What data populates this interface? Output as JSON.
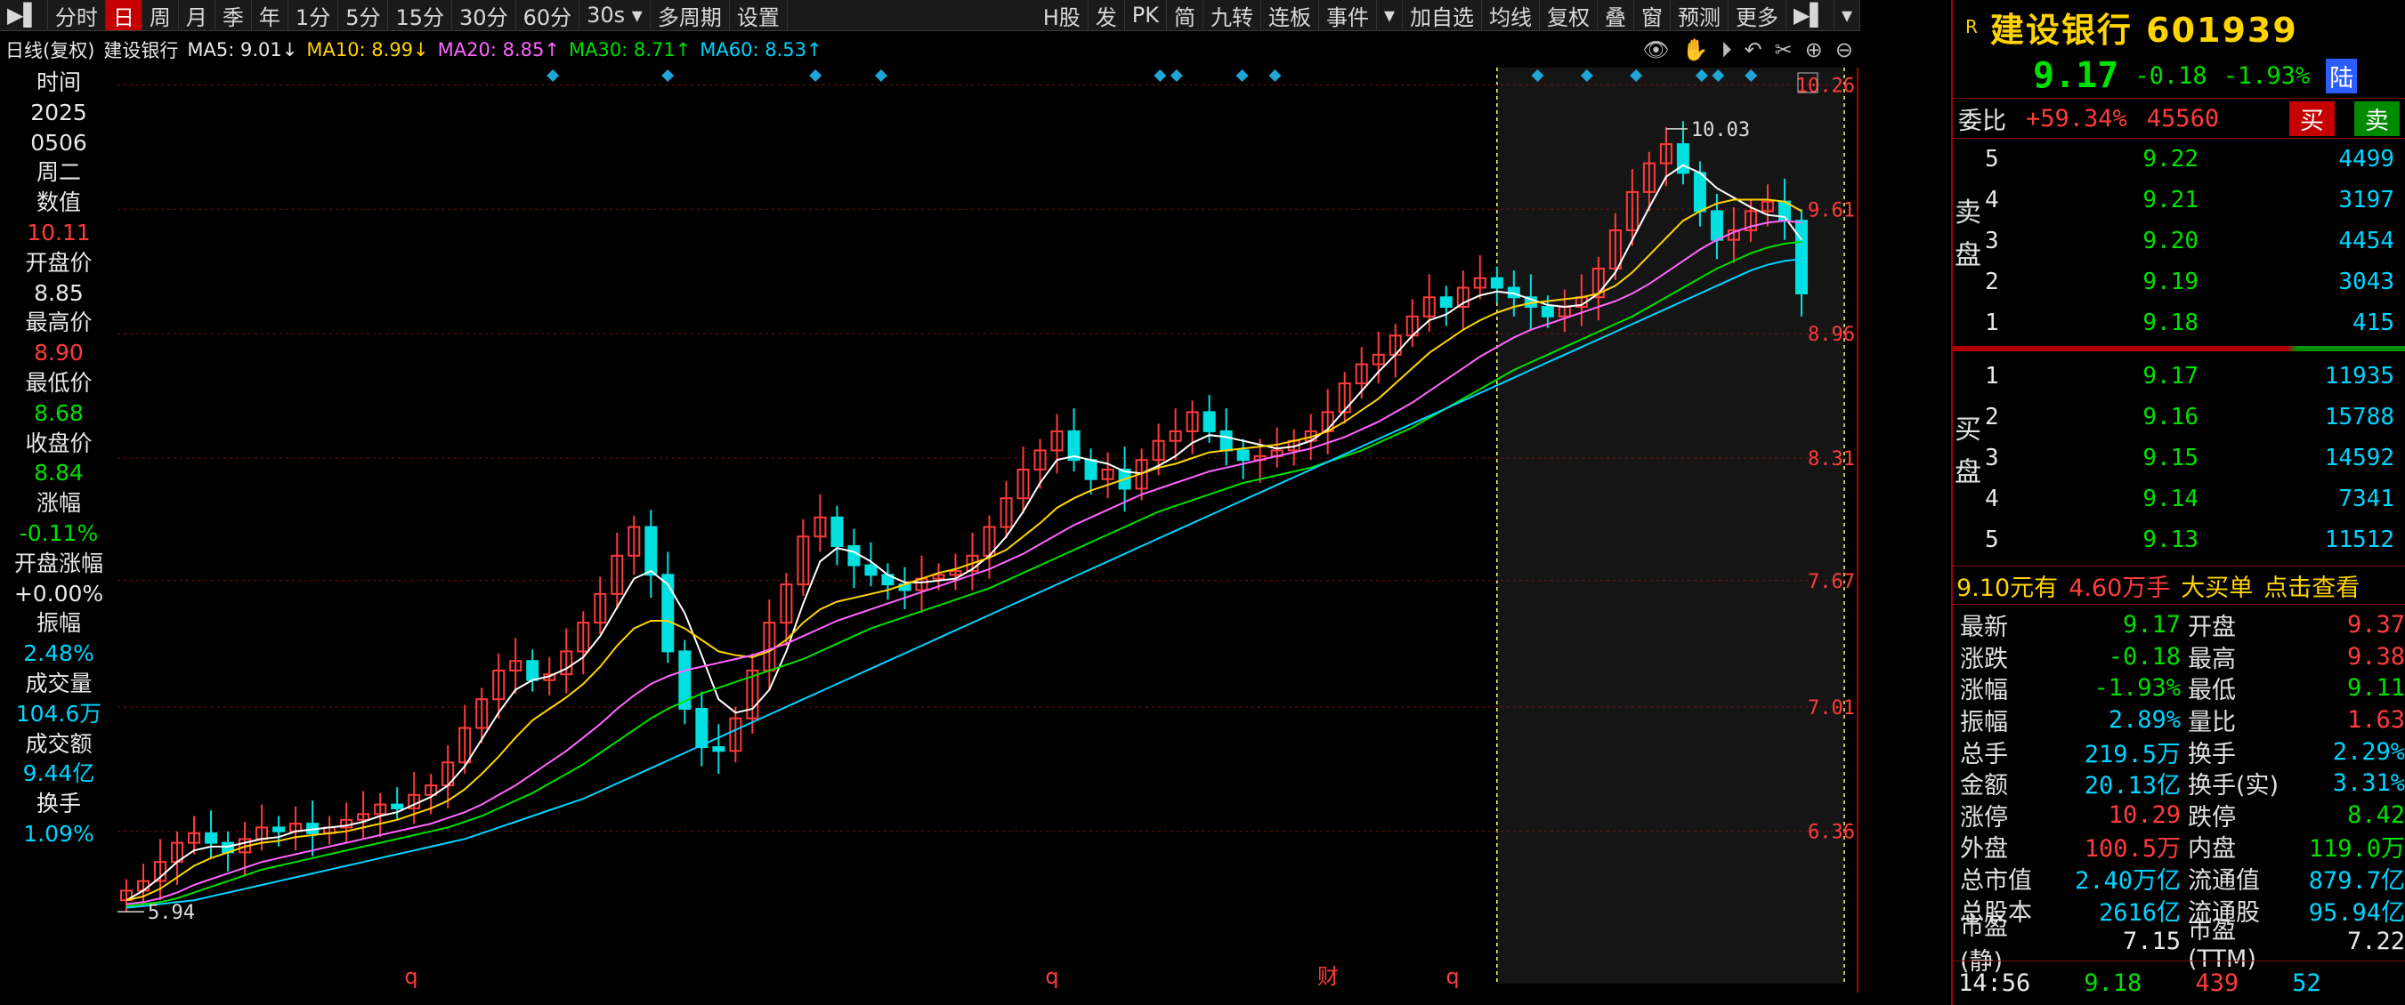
{
  "toolbar": {
    "items": [
      "分时",
      "日",
      "周",
      "月",
      "季",
      "年",
      "1分",
      "5分",
      "15分",
      "30分",
      "60分",
      "30s ▾",
      "多周期",
      "设置"
    ],
    "active_index": 1,
    "right_items": [
      "H股",
      "发",
      "PK",
      "简",
      "九转",
      "连板",
      "事件",
      "▾",
      "加自选",
      "均线",
      "复权",
      "叠",
      "窗",
      "预测",
      "更多"
    ]
  },
  "indicator": {
    "period": "日线(复权)",
    "stock": "建设银行",
    "ma5": "MA5: 9.01↓",
    "ma10": "MA10: 8.99↓",
    "ma20": "MA20: 8.85↑",
    "ma30": "MA30: 8.71↑",
    "ma60": "MA60: 8.53↑"
  },
  "left_panel": {
    "rows": [
      {
        "label": "时间",
        "value": "2025"
      },
      {
        "label": "",
        "value": "0506"
      },
      {
        "label": "",
        "value": "周二"
      },
      {
        "label": "数值",
        "value": "10.11"
      },
      {
        "label": "开盘价",
        "value": "8.85"
      },
      {
        "label": "最高价",
        "value": "8.90"
      },
      {
        "label": "最低价",
        "value": "8.68"
      },
      {
        "label": "收盘价",
        "value": "8.84"
      },
      {
        "label": "涨幅",
        "value": "-0.11%"
      },
      {
        "label": "开盘涨幅",
        "value": "+0.00%"
      },
      {
        "label": "振幅",
        "value": "2.48%"
      },
      {
        "label": "成交量",
        "value": "104.6万"
      },
      {
        "label": "成交额",
        "value": "9.44亿"
      },
      {
        "label": "换手",
        "value": "1.09%"
      }
    ]
  },
  "chart_data": {
    "type": "line",
    "title": "",
    "y_ticks": [
      "10.26",
      "9.61",
      "8.96",
      "8.31",
      "7.67",
      "7.01",
      "6.36"
    ],
    "ylim": [
      5.75,
      10.35
    ],
    "high_label": "10.03",
    "low_label": "5.94",
    "bottom_markers": [
      "q",
      "q",
      "财",
      "q"
    ],
    "series": [
      {
        "name": "close",
        "color": "#ff3b3b",
        "values": [
          6.05,
          6.1,
          6.2,
          6.3,
          6.35,
          6.3,
          6.25,
          6.32,
          6.38,
          6.36,
          6.4,
          6.35,
          6.38,
          6.42,
          6.45,
          6.5,
          6.48,
          6.55,
          6.6,
          6.72,
          6.9,
          7.05,
          7.2,
          7.25,
          7.15,
          7.18,
          7.3,
          7.45,
          7.6,
          7.8,
          7.95,
          7.7,
          7.3,
          7.0,
          6.8,
          6.78,
          6.95,
          7.2,
          7.45,
          7.65,
          7.9,
          8.0,
          7.85,
          7.75,
          7.7,
          7.65,
          7.62,
          7.68,
          7.7,
          7.72,
          7.8,
          7.95,
          8.1,
          8.25,
          8.35,
          8.45,
          8.3,
          8.2,
          8.25,
          8.15,
          8.3,
          8.4,
          8.45,
          8.55,
          8.45,
          8.35,
          8.3,
          8.32,
          8.35,
          8.4,
          8.45,
          8.55,
          8.7,
          8.8,
          8.85,
          8.95,
          9.05,
          9.15,
          9.1,
          9.2,
          9.25,
          9.2,
          9.15,
          9.1,
          9.05,
          9.1,
          9.15,
          9.3,
          9.5,
          9.7,
          9.85,
          9.95,
          9.8,
          9.6,
          9.45,
          9.5,
          9.6,
          9.65,
          9.55,
          9.17
        ]
      },
      {
        "name": "MA5",
        "color": "#ffffff",
        "values": [
          6.0,
          6.05,
          6.12,
          6.2,
          6.26,
          6.28,
          6.28,
          6.3,
          6.32,
          6.33,
          6.36,
          6.37,
          6.38,
          6.39,
          6.41,
          6.44,
          6.46,
          6.5,
          6.54,
          6.6,
          6.7,
          6.84,
          6.98,
          7.1,
          7.15,
          7.17,
          7.21,
          7.27,
          7.38,
          7.53,
          7.68,
          7.72,
          7.65,
          7.5,
          7.28,
          7.05,
          6.98,
          7.0,
          7.1,
          7.3,
          7.55,
          7.77,
          7.84,
          7.82,
          7.77,
          7.7,
          7.66,
          7.66,
          7.67,
          7.68,
          7.73,
          7.8,
          7.9,
          8.03,
          8.18,
          8.3,
          8.32,
          8.3,
          8.28,
          8.24,
          8.23,
          8.27,
          8.32,
          8.39,
          8.43,
          8.42,
          8.4,
          8.38,
          8.36,
          8.37,
          8.4,
          8.46,
          8.56,
          8.66,
          8.76,
          8.85,
          8.95,
          9.03,
          9.06,
          9.12,
          9.16,
          9.18,
          9.17,
          9.14,
          9.11,
          9.1,
          9.11,
          9.17,
          9.28,
          9.45,
          9.62,
          9.78,
          9.84,
          9.8,
          9.72,
          9.67,
          9.62,
          9.58,
          9.57,
          9.45
        ]
      },
      {
        "name": "MA10",
        "color": "#ffd400",
        "values": [
          6.0,
          6.02,
          6.06,
          6.12,
          6.18,
          6.22,
          6.25,
          6.28,
          6.3,
          6.31,
          6.33,
          6.34,
          6.35,
          6.36,
          6.38,
          6.4,
          6.42,
          6.45,
          6.48,
          6.52,
          6.58,
          6.66,
          6.75,
          6.85,
          6.94,
          7.0,
          7.06,
          7.13,
          7.22,
          7.33,
          7.42,
          7.46,
          7.46,
          7.42,
          7.36,
          7.3,
          7.28,
          7.27,
          7.3,
          7.36,
          7.45,
          7.52,
          7.56,
          7.58,
          7.6,
          7.62,
          7.65,
          7.68,
          7.71,
          7.73,
          7.76,
          7.79,
          7.83,
          7.9,
          7.97,
          8.05,
          8.1,
          8.14,
          8.17,
          8.2,
          8.23,
          8.26,
          8.28,
          8.31,
          8.34,
          8.35,
          8.36,
          8.37,
          8.38,
          8.4,
          8.42,
          8.45,
          8.5,
          8.56,
          8.62,
          8.7,
          8.78,
          8.86,
          8.92,
          8.98,
          9.03,
          9.07,
          9.1,
          9.12,
          9.13,
          9.14,
          9.15,
          9.17,
          9.21,
          9.28,
          9.37,
          9.46,
          9.55,
          9.6,
          9.64,
          9.66,
          9.66,
          9.66,
          9.65,
          9.6
        ]
      },
      {
        "name": "MA20",
        "color": "#ff66ff",
        "values": [
          5.98,
          5.99,
          6.01,
          6.04,
          6.08,
          6.11,
          6.14,
          6.17,
          6.2,
          6.22,
          6.24,
          6.26,
          6.28,
          6.3,
          6.32,
          6.34,
          6.36,
          6.38,
          6.4,
          6.43,
          6.46,
          6.5,
          6.55,
          6.6,
          6.66,
          6.72,
          6.78,
          6.85,
          6.92,
          7.0,
          7.07,
          7.13,
          7.17,
          7.2,
          7.22,
          7.24,
          7.26,
          7.28,
          7.31,
          7.34,
          7.38,
          7.42,
          7.46,
          7.49,
          7.52,
          7.55,
          7.58,
          7.61,
          7.64,
          7.67,
          7.7,
          7.73,
          7.77,
          7.81,
          7.86,
          7.91,
          7.96,
          8.0,
          8.04,
          8.08,
          8.12,
          8.15,
          8.18,
          8.21,
          8.24,
          8.26,
          8.28,
          8.3,
          8.32,
          8.34,
          8.36,
          8.39,
          8.42,
          8.46,
          8.5,
          8.55,
          8.6,
          8.66,
          8.72,
          8.78,
          8.84,
          8.89,
          8.94,
          8.98,
          9.01,
          9.04,
          9.07,
          9.1,
          9.13,
          9.17,
          9.22,
          9.28,
          9.34,
          9.4,
          9.45,
          9.49,
          9.52,
          9.54,
          9.55,
          9.54
        ]
      },
      {
        "name": "MA30",
        "color": "#00e000",
        "values": [
          5.97,
          5.98,
          5.99,
          6.01,
          6.04,
          6.07,
          6.1,
          6.13,
          6.16,
          6.18,
          6.2,
          6.22,
          6.24,
          6.26,
          6.28,
          6.3,
          6.32,
          6.34,
          6.36,
          6.38,
          6.41,
          6.44,
          6.48,
          6.52,
          6.56,
          6.61,
          6.66,
          6.71,
          6.77,
          6.83,
          6.89,
          6.95,
          7.0,
          7.04,
          7.08,
          7.11,
          7.14,
          7.17,
          7.2,
          7.23,
          7.26,
          7.3,
          7.34,
          7.38,
          7.42,
          7.45,
          7.48,
          7.51,
          7.54,
          7.57,
          7.6,
          7.63,
          7.67,
          7.71,
          7.75,
          7.79,
          7.83,
          7.87,
          7.91,
          7.95,
          7.99,
          8.03,
          8.06,
          8.09,
          8.12,
          8.15,
          8.18,
          8.2,
          8.22,
          8.24,
          8.26,
          8.29,
          8.32,
          8.35,
          8.39,
          8.43,
          8.47,
          8.52,
          8.57,
          8.62,
          8.67,
          8.72,
          8.77,
          8.81,
          8.85,
          8.89,
          8.93,
          8.97,
          9.01,
          9.05,
          9.1,
          9.15,
          9.2,
          9.25,
          9.3,
          9.34,
          9.38,
          9.41,
          9.43,
          9.44
        ]
      },
      {
        "name": "MA60",
        "color": "#00d4ff",
        "values": [
          5.96,
          5.97,
          5.98,
          5.99,
          6.0,
          6.02,
          6.04,
          6.06,
          6.08,
          6.1,
          6.12,
          6.14,
          6.16,
          6.18,
          6.2,
          6.22,
          6.24,
          6.26,
          6.28,
          6.3,
          6.32,
          6.35,
          6.38,
          6.41,
          6.44,
          6.47,
          6.5,
          6.53,
          6.57,
          6.61,
          6.65,
          6.69,
          6.73,
          6.77,
          6.81,
          6.85,
          6.89,
          6.93,
          6.97,
          7.01,
          7.05,
          7.09,
          7.13,
          7.17,
          7.21,
          7.25,
          7.29,
          7.33,
          7.37,
          7.41,
          7.45,
          7.49,
          7.53,
          7.57,
          7.61,
          7.65,
          7.69,
          7.73,
          7.77,
          7.81,
          7.85,
          7.89,
          7.93,
          7.97,
          8.01,
          8.05,
          8.09,
          8.13,
          8.17,
          8.21,
          8.25,
          8.29,
          8.33,
          8.37,
          8.41,
          8.45,
          8.49,
          8.53,
          8.57,
          8.61,
          8.65,
          8.69,
          8.73,
          8.77,
          8.81,
          8.85,
          8.89,
          8.93,
          8.97,
          9.01,
          9.05,
          9.09,
          9.13,
          9.17,
          9.21,
          9.25,
          9.29,
          9.32,
          9.34,
          9.35
        ]
      }
    ]
  },
  "right_panel": {
    "title": "建设银行 601939",
    "price": "9.17",
    "change": "-0.18",
    "change_pct": "-1.93%",
    "market_tag": "陆",
    "weibi_label": "委比",
    "weibi_value": "+59.34%",
    "weibi_diff": "45560",
    "buy_btn": "买",
    "sell_btn": "卖",
    "sell_side": "卖盘",
    "buy_side": "买盘",
    "asks": [
      {
        "level": "5",
        "price": "9.22",
        "vol": "4499"
      },
      {
        "level": "4",
        "price": "9.21",
        "vol": "3197"
      },
      {
        "level": "3",
        "price": "9.20",
        "vol": "4454"
      },
      {
        "level": "2",
        "price": "9.19",
        "vol": "3043"
      },
      {
        "level": "1",
        "price": "9.18",
        "vol": "415"
      }
    ],
    "bids": [
      {
        "level": "1",
        "price": "9.17",
        "vol": "11935"
      },
      {
        "level": "2",
        "price": "9.16",
        "vol": "15788"
      },
      {
        "level": "3",
        "price": "9.15",
        "vol": "14592"
      },
      {
        "level": "4",
        "price": "9.14",
        "vol": "7341"
      },
      {
        "level": "5",
        "price": "9.13",
        "vol": "11512"
      }
    ],
    "big_order": {
      "price_text": "9.10元有",
      "amount": "4.60万手",
      "label": "大买单",
      "link": "点击查看"
    },
    "quotes": [
      {
        "l": "最新",
        "v": "9.17",
        "vc": "green",
        "l2": "开盘",
        "v2": "9.37",
        "v2c": "red"
      },
      {
        "l": "涨跌",
        "v": "-0.18",
        "vc": "green",
        "l2": "最高",
        "v2": "9.38",
        "v2c": "red"
      },
      {
        "l": "涨幅",
        "v": "-1.93%",
        "vc": "green",
        "l2": "最低",
        "v2": "9.11",
        "v2c": "green"
      },
      {
        "l": "振幅",
        "v": "2.89%",
        "vc": "cyan",
        "l2": "量比",
        "v2": "1.63",
        "v2c": "red"
      },
      {
        "l": "总手",
        "v": "219.5万",
        "vc": "cyan",
        "l2": "换手",
        "v2": "2.29%",
        "v2c": "cyan"
      },
      {
        "l": "金额",
        "v": "20.13亿",
        "vc": "cyan",
        "l2": "换手(实)",
        "v2": "3.31%",
        "v2c": "cyan"
      },
      {
        "l": "涨停",
        "v": "10.29",
        "vc": "red",
        "l2": "跌停",
        "v2": "8.42",
        "v2c": "green"
      },
      {
        "l": "外盘",
        "v": "100.5万",
        "vc": "red",
        "l2": "内盘",
        "v2": "119.0万",
        "v2c": "green"
      },
      {
        "l": "总市值",
        "v": "2.40万亿",
        "vc": "cyan",
        "l2": "流通值",
        "v2": "879.7亿",
        "v2c": "cyan"
      },
      {
        "l": "总股本",
        "v": "2616亿",
        "vc": "cyan",
        "l2": "流通股",
        "v2": "95.94亿",
        "v2c": "cyan"
      },
      {
        "l": "市盈(静)",
        "v": "7.15",
        "vc": "white",
        "l2": "市盈(TTM)",
        "v2": "7.22",
        "v2c": "white"
      }
    ],
    "tick": {
      "time": "14:56",
      "price": "9.18",
      "vol": "439",
      "extra": "52"
    }
  },
  "colors": {
    "up": "#ff3b3b",
    "down": "#00e000",
    "accent": "#ffd400",
    "grid": "#7a1010",
    "cyan": "#00d4ff"
  }
}
